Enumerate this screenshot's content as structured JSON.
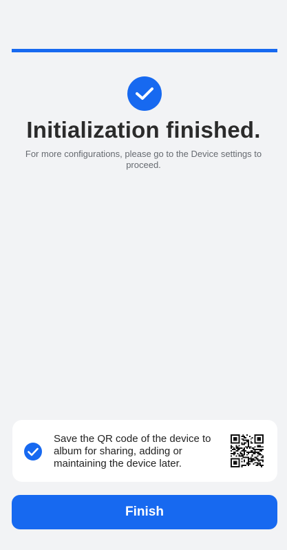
{
  "progress": {
    "value": 1.0,
    "color": "#1769f0"
  },
  "header": {
    "title": "Initialization finished.",
    "subtitle": "For more configurations, please go to the Device settings to proceed."
  },
  "qr_option": {
    "checked": true,
    "text": "Save the QR code of the device to album for sharing, adding or maintaining the device later.",
    "icon": "qr-code-icon"
  },
  "actions": {
    "finish_label": "Finish"
  },
  "colors": {
    "accent": "#1769f0",
    "background": "#f2f3f5",
    "card": "#ffffff"
  }
}
